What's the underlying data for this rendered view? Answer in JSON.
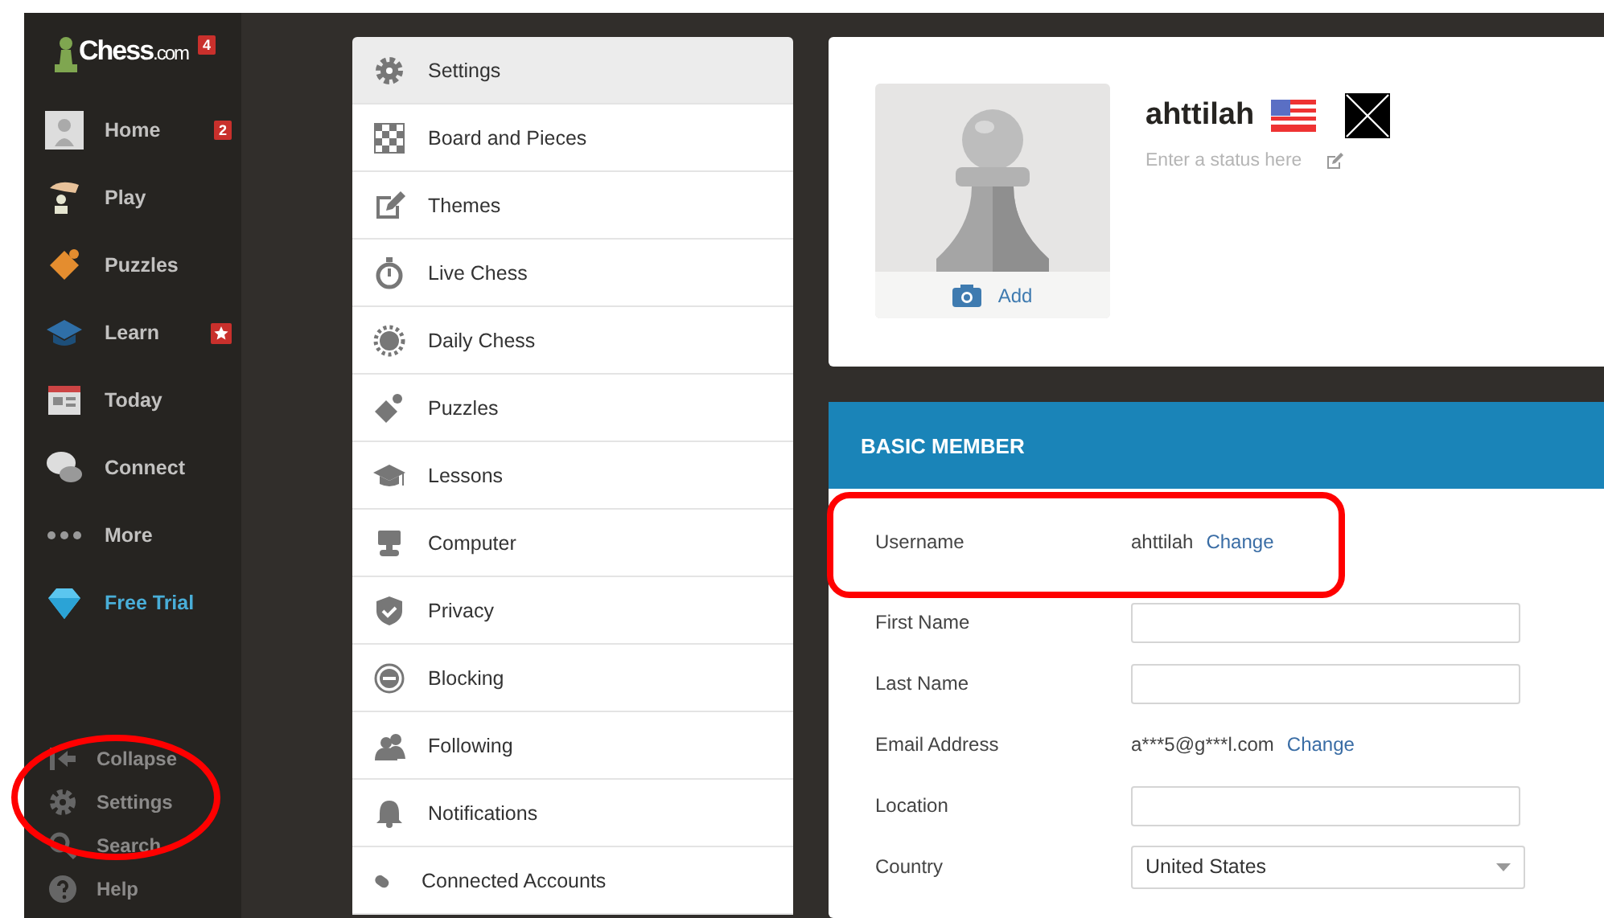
{
  "logo": {
    "text": "Chess",
    "suffix": ".com",
    "badge": "4"
  },
  "sidebar": {
    "items": [
      {
        "label": "Home",
        "badge": "2",
        "promo": false
      },
      {
        "label": "Play",
        "promo": false
      },
      {
        "label": "Puzzles",
        "promo": false
      },
      {
        "label": "Learn",
        "star_badge": true,
        "promo": false
      },
      {
        "label": "Today",
        "promo": false
      },
      {
        "label": "Connect",
        "promo": false
      },
      {
        "label": "More",
        "promo": false
      },
      {
        "label": "Free Trial",
        "promo": true
      }
    ],
    "footer": [
      {
        "label": "Collapse"
      },
      {
        "label": "Settings"
      },
      {
        "label": "Search"
      },
      {
        "label": "Help"
      }
    ]
  },
  "settings_menu": [
    {
      "label": "Settings",
      "selected": true
    },
    {
      "label": "Board and Pieces",
      "selected": false
    },
    {
      "label": "Themes",
      "selected": false
    },
    {
      "label": "Live Chess",
      "selected": false
    },
    {
      "label": "Daily Chess",
      "selected": false
    },
    {
      "label": "Puzzles",
      "selected": false
    },
    {
      "label": "Lessons",
      "selected": false
    },
    {
      "label": "Computer",
      "selected": false
    },
    {
      "label": "Privacy",
      "selected": false
    },
    {
      "label": "Blocking",
      "selected": false
    },
    {
      "label": "Following",
      "selected": false
    },
    {
      "label": "Notifications",
      "selected": false
    },
    {
      "label": "Connected Accounts",
      "selected": false
    }
  ],
  "profile": {
    "username": "ahttilah",
    "avatar_action": "Add",
    "status": {
      "placeholder": "Enter a status here"
    }
  },
  "membership": {
    "title": "BASIC MEMBER",
    "rows": [
      {
        "label": "Username",
        "kind": "text",
        "value": "ahttilah",
        "link": "Change"
      },
      {
        "label": "First Name",
        "kind": "input"
      },
      {
        "label": "Last Name",
        "kind": "input"
      },
      {
        "label": "Email Address",
        "kind": "text",
        "value": "a***5@g***l.com",
        "link": "Change"
      },
      {
        "label": "Location",
        "kind": "input"
      },
      {
        "label": "Country",
        "kind": "select",
        "value": "United States"
      }
    ]
  },
  "annotations": [
    {
      "kind": "ellipse"
    },
    {
      "kind": "rect"
    }
  ]
}
